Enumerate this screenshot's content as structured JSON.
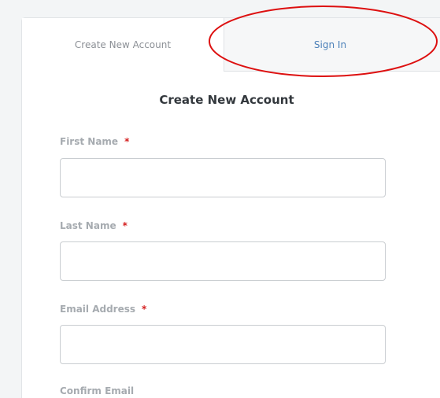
{
  "tabs": {
    "create_label": "Create New Account",
    "signin_label": "Sign In"
  },
  "form": {
    "title": "Create New Account",
    "required_marker": "*",
    "fields": [
      {
        "label": "First Name",
        "value": "",
        "required": true
      },
      {
        "label": "Last Name",
        "value": "",
        "required": true
      },
      {
        "label": "Email Address",
        "value": "",
        "required": true
      },
      {
        "label": "Confirm Email",
        "required": false
      }
    ]
  },
  "colors": {
    "page_background": "#f3f5f6",
    "link_blue": "#4a7fb8",
    "required_red": "#d41f1f",
    "annotation_red": "#dd1010"
  }
}
